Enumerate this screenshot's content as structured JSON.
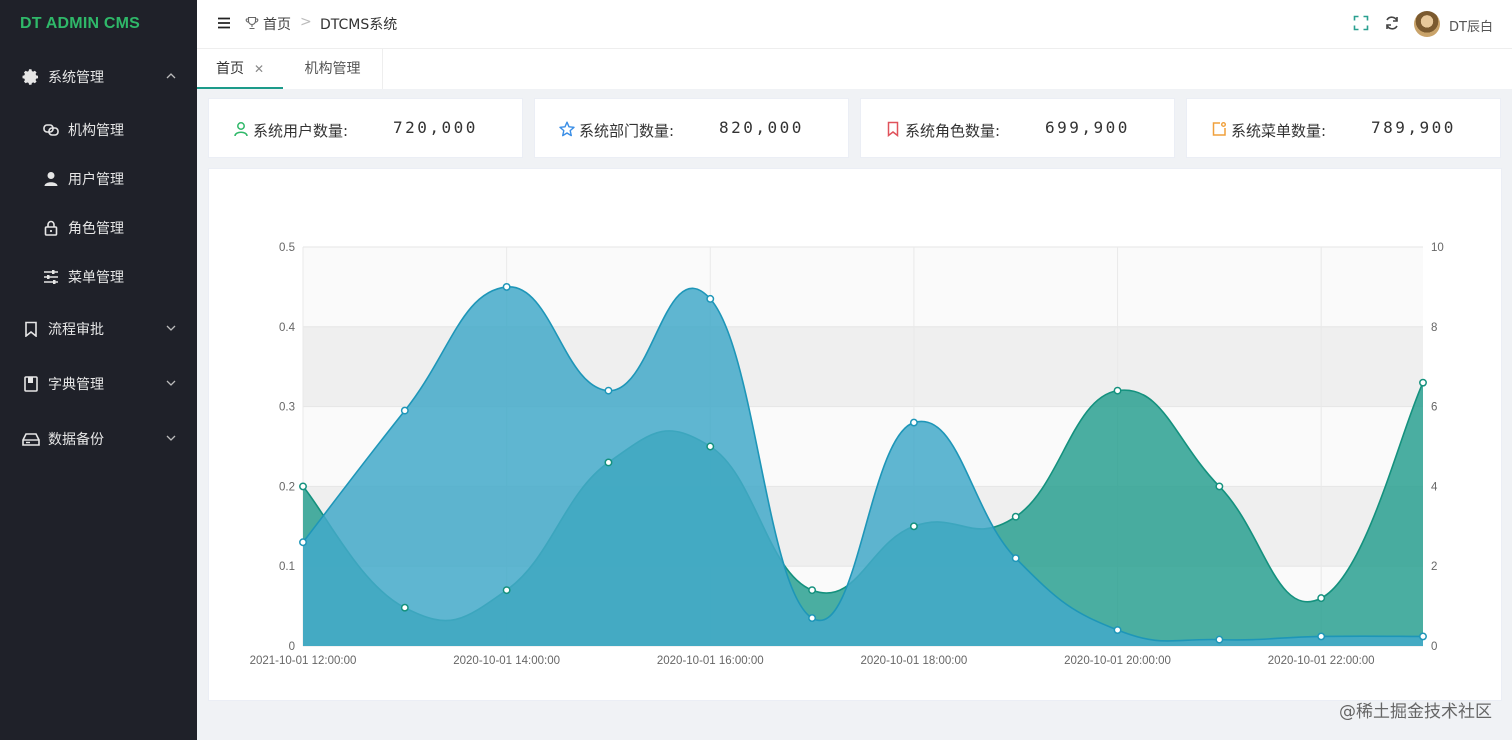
{
  "app": {
    "logo": "DT ADMIN CMS"
  },
  "sidebar": {
    "items": [
      {
        "label": "系统管理",
        "icon": "gear-icon",
        "expanded": true
      },
      {
        "label": "流程审批",
        "icon": "bookmark-icon",
        "expanded": false
      },
      {
        "label": "字典管理",
        "icon": "book-icon",
        "expanded": false
      },
      {
        "label": "数据备份",
        "icon": "drive-icon",
        "expanded": false
      }
    ],
    "subitems": [
      {
        "label": "机构管理",
        "icon": "link-icon"
      },
      {
        "label": "用户管理",
        "icon": "user-icon"
      },
      {
        "label": "角色管理",
        "icon": "lock-icon"
      },
      {
        "label": "菜单管理",
        "icon": "sliders-icon"
      }
    ]
  },
  "header": {
    "breadcrumb": [
      "首页",
      "DTCMS系统"
    ],
    "user_name": "DT辰白"
  },
  "tabs": [
    {
      "label": "首页",
      "active": true,
      "closable": true
    },
    {
      "label": "机构管理",
      "active": false,
      "closable": false
    }
  ],
  "stats": [
    {
      "label": "系统用户数量:",
      "value": "720,000",
      "icon": "user-outline-icon",
      "color": "#2fb869"
    },
    {
      "label": "系统部门数量:",
      "value": "820,000",
      "icon": "star-icon",
      "color": "#3a8ee6"
    },
    {
      "label": "系统角色数量:",
      "value": "699,900",
      "icon": "bookmark-icon",
      "color": "#e0525b"
    },
    {
      "label": "系统菜单数量:",
      "value": "789,900",
      "icon": "edit-icon",
      "color": "#f0a03c"
    }
  ],
  "chart_data": {
    "type": "area",
    "x": [
      "2021-10-01 12:00:00",
      "",
      "2020-10-01 14:00:00",
      "",
      "2020-10-01 16:00:00",
      "",
      "2020-10-01 18:00:00",
      "",
      "2020-10-01 20:00:00",
      "",
      "2020-10-01 22:00:00",
      ""
    ],
    "y_left": {
      "ylim": [
        0,
        0.5
      ],
      "ticks": [
        "0",
        "0.1",
        "0.2",
        "0.3",
        "0.4",
        "0.5"
      ]
    },
    "y_right": {
      "ylim": [
        0,
        10
      ],
      "ticks": [
        "0",
        "2",
        "4",
        "6",
        "8",
        "10"
      ]
    },
    "series": [
      {
        "axis": "left",
        "color": "#43a9c9",
        "values": [
          0.13,
          0.295,
          0.45,
          0.32,
          0.435,
          0.035,
          0.28,
          0.11,
          0.02,
          0.008,
          0.012,
          0.012
        ]
      },
      {
        "axis": "left",
        "color": "#2aa090",
        "values": [
          0.2,
          0.048,
          0.07,
          0.23,
          0.25,
          0.07,
          0.15,
          0.162,
          0.32,
          0.2,
          0.06,
          0.33
        ]
      }
    ],
    "grid": true,
    "legend": "none"
  },
  "watermark": "@稀土掘金技术社区"
}
